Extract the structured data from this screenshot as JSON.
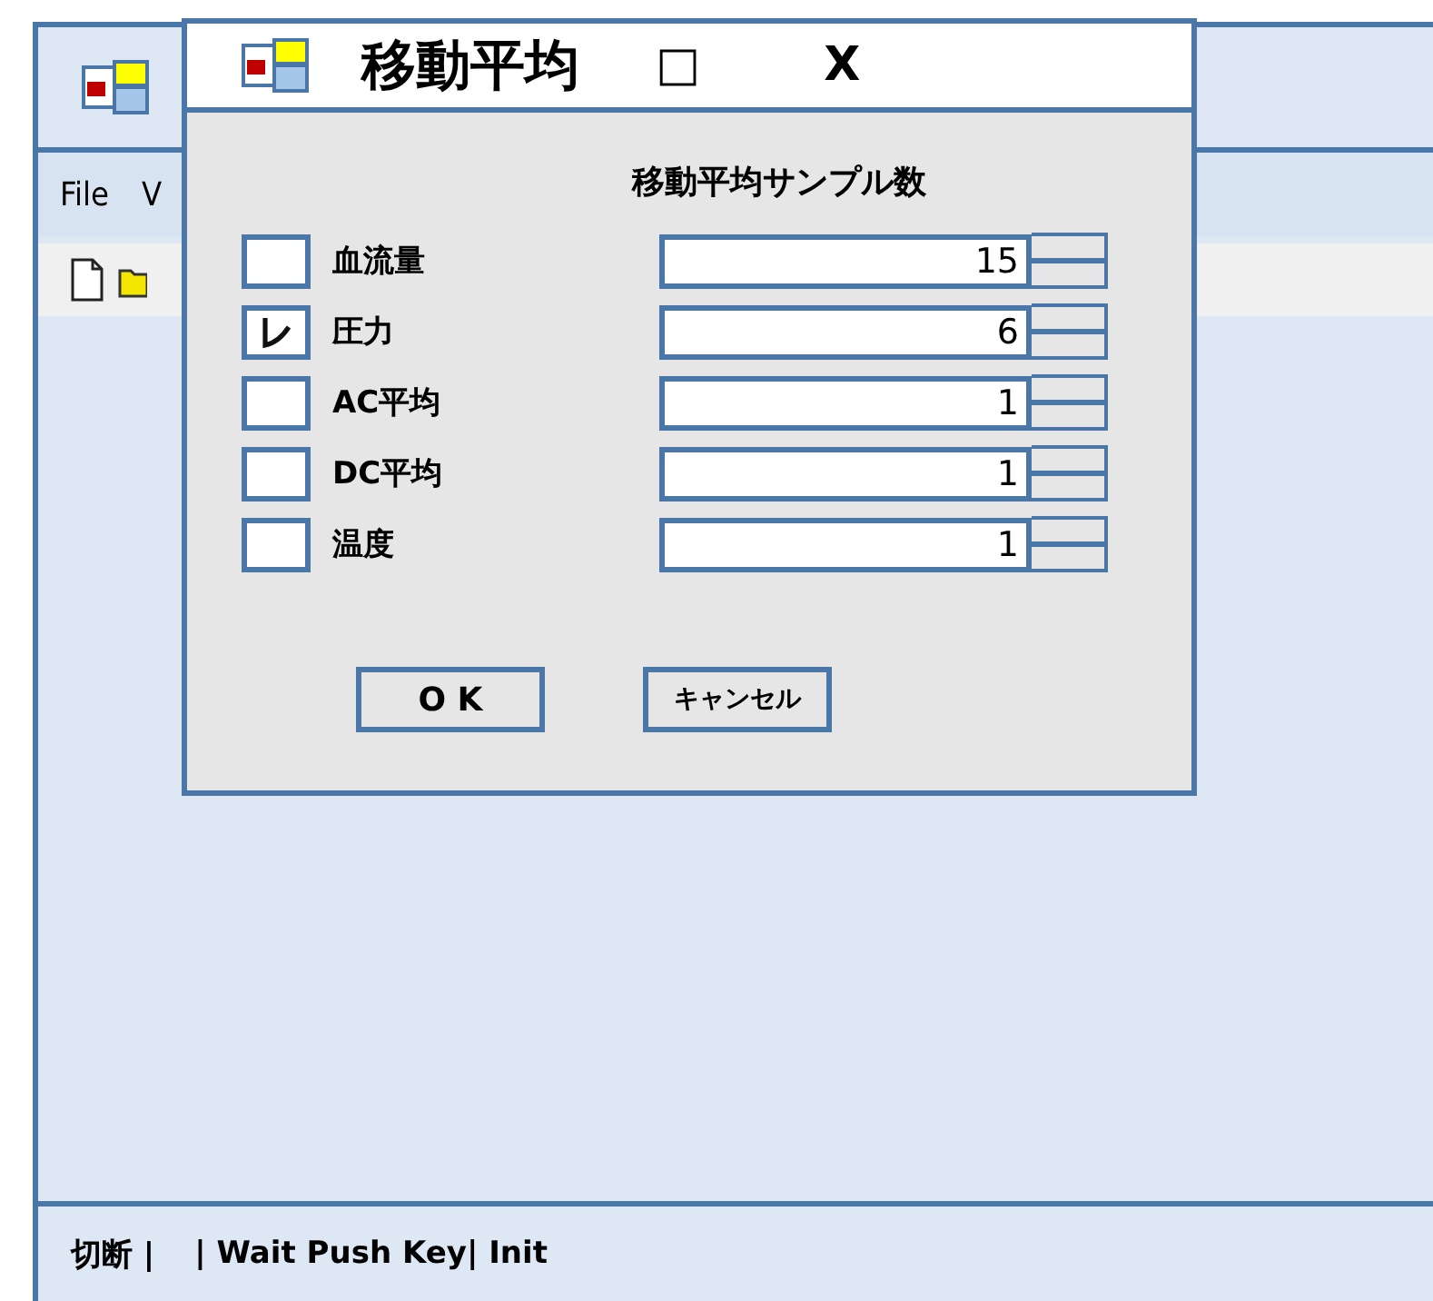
{
  "main_window": {
    "menu": [
      {
        "label": "File"
      },
      {
        "label": "V"
      }
    ]
  },
  "dialog": {
    "title": "移動平均",
    "maximize_button": "□",
    "close_button": "X",
    "column_header": "移動平均サンプル数",
    "rows": [
      {
        "label": "血流量",
        "checked": false,
        "value": "15"
      },
      {
        "label": "圧力",
        "checked": true,
        "value": "6"
      },
      {
        "label": "AC平均",
        "checked": false,
        "value": "1"
      },
      {
        "label": "DC平均",
        "checked": false,
        "value": "1"
      },
      {
        "label": "温度",
        "checked": false,
        "value": "1"
      }
    ],
    "buttons": [
      {
        "label": "O K"
      },
      {
        "label": "キャンセル"
      }
    ]
  },
  "status_bar": [
    {
      "text": "切断 |"
    },
    {
      "text": "| Wait Push Key| Init"
    }
  ]
}
